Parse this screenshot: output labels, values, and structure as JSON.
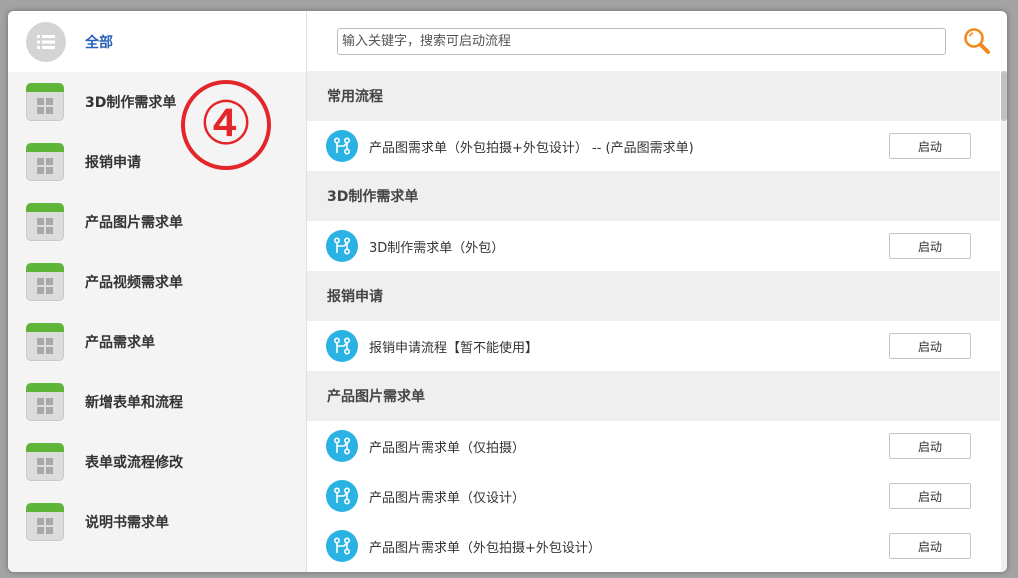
{
  "sidebar": {
    "all_label": "全部",
    "items": [
      {
        "label": "3D制作需求单"
      },
      {
        "label": "报销申请"
      },
      {
        "label": "产品图片需求单"
      },
      {
        "label": "产品视频需求单"
      },
      {
        "label": "产品需求单"
      },
      {
        "label": "新增表单和流程"
      },
      {
        "label": "表单或流程修改"
      },
      {
        "label": "说明书需求单"
      }
    ]
  },
  "annotation": {
    "marker": "④"
  },
  "search": {
    "placeholder": "输入关键字，搜索可启动流程"
  },
  "sections": [
    {
      "title": "常用流程",
      "flows": [
        {
          "label": "产品图需求单（外包拍摄+外包设计） -- (产品图需求单)",
          "button": "启动"
        }
      ]
    },
    {
      "title": "3D制作需求单",
      "flows": [
        {
          "label": "3D制作需求单（外包）",
          "button": "启动"
        }
      ]
    },
    {
      "title": "报销申请",
      "flows": [
        {
          "label": "报销申请流程【暂不能使用】",
          "button": "启动"
        }
      ]
    },
    {
      "title": "产品图片需求单",
      "flows": [
        {
          "label": "产品图片需求单（仅拍摄）",
          "button": "启动"
        },
        {
          "label": "产品图片需求单（仅设计）",
          "button": "启动"
        },
        {
          "label": "产品图片需求单（外包拍摄+外包设计）",
          "button": "启动"
        }
      ]
    }
  ],
  "colors": {
    "accent_blue": "#2a62b8",
    "flow_icon": "#29b2e3",
    "search_icon": "#f08a1c",
    "marker_red": "#e3262a",
    "form_icon_green": "#5fb43a"
  }
}
